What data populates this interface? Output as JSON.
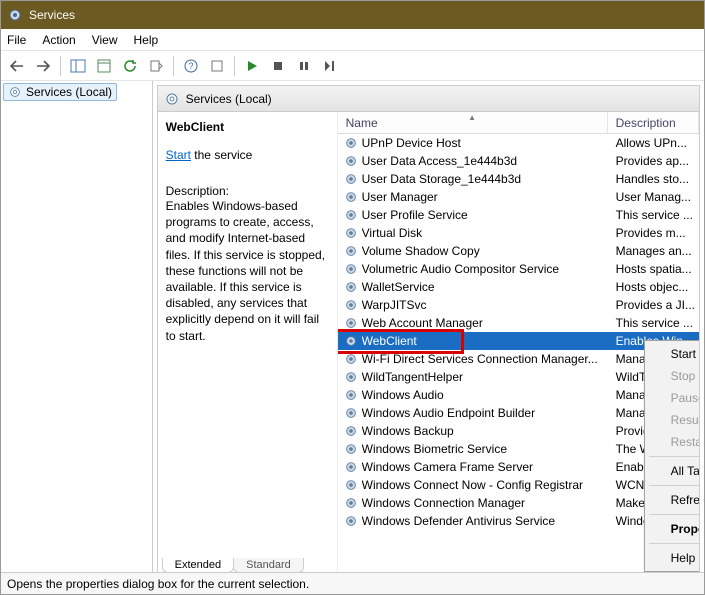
{
  "window": {
    "title": "Services"
  },
  "menu": {
    "file": "File",
    "action": "Action",
    "view": "View",
    "help": "Help"
  },
  "tree": {
    "root": "Services (Local)"
  },
  "right_header": "Services (Local)",
  "columns": {
    "name": "Name",
    "description": "Description"
  },
  "detail": {
    "name": "WebClient",
    "start_link": "Start",
    "start_tail": " the service",
    "desc_label": "Description:",
    "desc_text": "Enables Windows-based programs to create, access, and modify Internet-based files. If this service is stopped, these functions will not be available. If this service is disabled, any services that explicitly depend on it will fail to start."
  },
  "services": [
    {
      "name": "UPnP Device Host",
      "desc": "Allows UPn..."
    },
    {
      "name": "User Data Access_1e444b3d",
      "desc": "Provides ap..."
    },
    {
      "name": "User Data Storage_1e444b3d",
      "desc": "Handles sto..."
    },
    {
      "name": "User Manager",
      "desc": "User Manag..."
    },
    {
      "name": "User Profile Service",
      "desc": "This service ..."
    },
    {
      "name": "Virtual Disk",
      "desc": "Provides m..."
    },
    {
      "name": "Volume Shadow Copy",
      "desc": "Manages an..."
    },
    {
      "name": "Volumetric Audio Compositor Service",
      "desc": "Hosts spatia..."
    },
    {
      "name": "WalletService",
      "desc": "Hosts objec..."
    },
    {
      "name": "WarpJITSvc",
      "desc": "Provides a JI..."
    },
    {
      "name": "Web Account Manager",
      "desc": "This service ..."
    },
    {
      "name": "WebClient",
      "desc": "Enables Win...",
      "selected": true
    },
    {
      "name": "Wi-Fi Direct Services Connection Manager...",
      "desc": "Manages co..."
    },
    {
      "name": "WildTangentHelper",
      "desc": "WildTangen..."
    },
    {
      "name": "Windows Audio",
      "desc": "Manages au..."
    },
    {
      "name": "Windows Audio Endpoint Builder",
      "desc": "Manages au..."
    },
    {
      "name": "Windows Backup",
      "desc": "Provides Wi..."
    },
    {
      "name": "Windows Biometric Service",
      "desc": "The Windo..."
    },
    {
      "name": "Windows Camera Frame Server",
      "desc": "Enables mul..."
    },
    {
      "name": "Windows Connect Now - Config Registrar",
      "desc": "WCNCSVC ..."
    },
    {
      "name": "Windows Connection Manager",
      "desc": "Makes auto..."
    },
    {
      "name": "Windows Defender Antivirus Service",
      "desc": "Windows D..."
    }
  ],
  "context_menu": {
    "start": "Start",
    "stop": "Stop",
    "pause": "Pause",
    "resume": "Resume",
    "restart": "Restart",
    "all_tasks": "All Tasks",
    "refresh": "Refresh",
    "properties": "Properties",
    "help": "Help"
  },
  "tabs": {
    "extended": "Extended",
    "standard": "Standard"
  },
  "status": "Opens the properties dialog box for the current selection."
}
